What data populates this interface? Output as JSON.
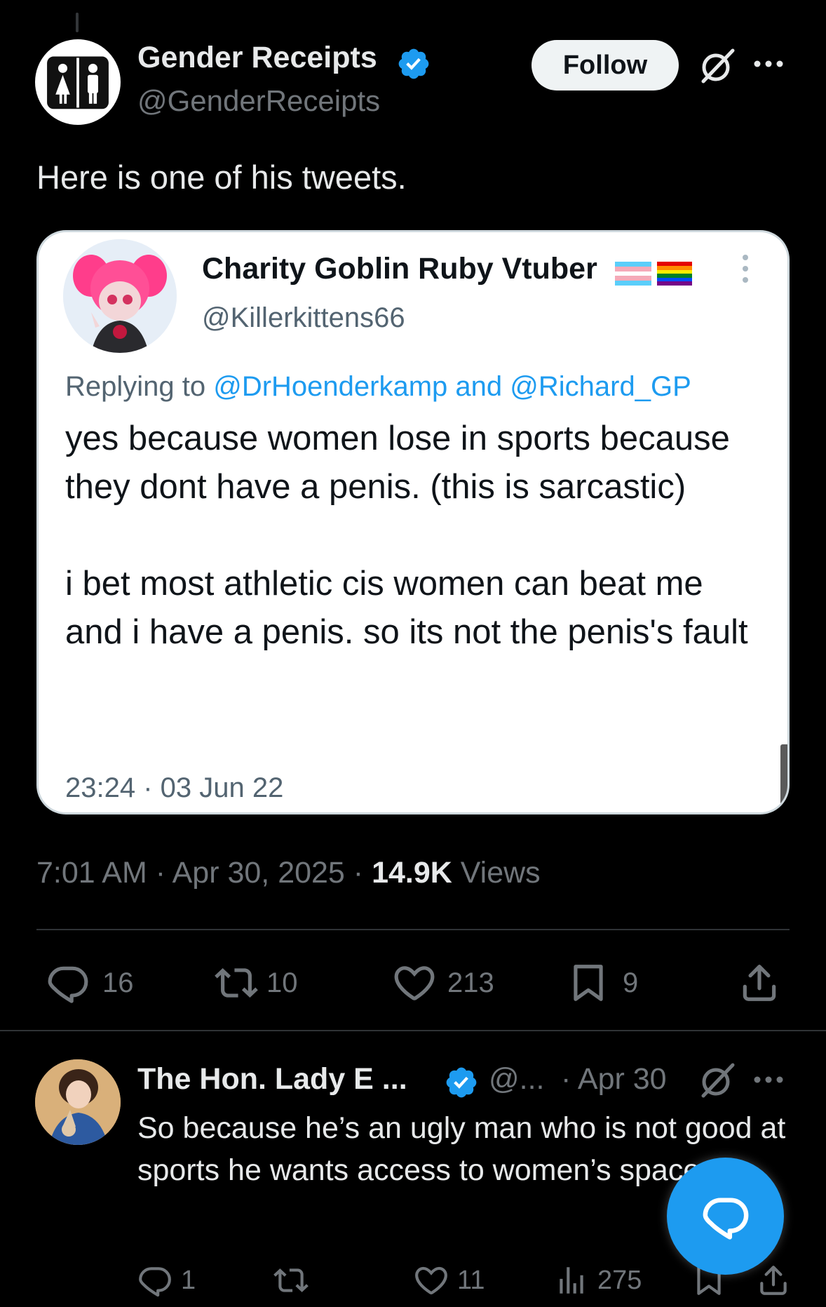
{
  "main_tweet": {
    "display_name": "Gender Receipts",
    "handle": "@GenderReceipts",
    "follow_label": "Follow",
    "text": "Here is one of his tweets.",
    "timestamp": "7:01 AM · Apr 30, 2025 · ",
    "views_count": "14.9K",
    "views_label": " Views",
    "stats": {
      "replies": "16",
      "retweets": "10",
      "likes": "213",
      "bookmarks": "9"
    }
  },
  "embedded_tweet": {
    "display_name": "Charity Goblin Ruby Vtuber",
    "handle": "@Killerkittens66",
    "replying_prefix": "Replying to ",
    "replying_to_1": "@DrHoenderkamp",
    "replying_and": " and ",
    "replying_to_2": "@Richard_GP",
    "paragraph_1": "yes because women lose in sports because they dont have a penis. (this is sarcastic)",
    "paragraph_2": " i bet most athletic cis women can beat me and i have a penis. so its not the penis's fault",
    "timestamp": "23:24 · 03 Jun 22"
  },
  "reply_tweet": {
    "display_name": "The Hon. Lady E ...",
    "handle": "@...",
    "date": "· Apr 30",
    "text": "So because he’s an ugly man who is not good at sports he wants access to women’s spaces",
    "stats": {
      "replies": "1",
      "likes": "11",
      "views": "275"
    }
  },
  "colors": {
    "background": "#000000",
    "accent": "#1d9bf0",
    "muted": "#71767b",
    "text": "#e7e9ea"
  },
  "icons": [
    "verified-badge-icon",
    "grok-icon",
    "more-icon",
    "reply-icon",
    "retweet-icon",
    "like-icon",
    "bookmark-icon",
    "share-icon",
    "views-icon",
    "compose-message-icon"
  ]
}
